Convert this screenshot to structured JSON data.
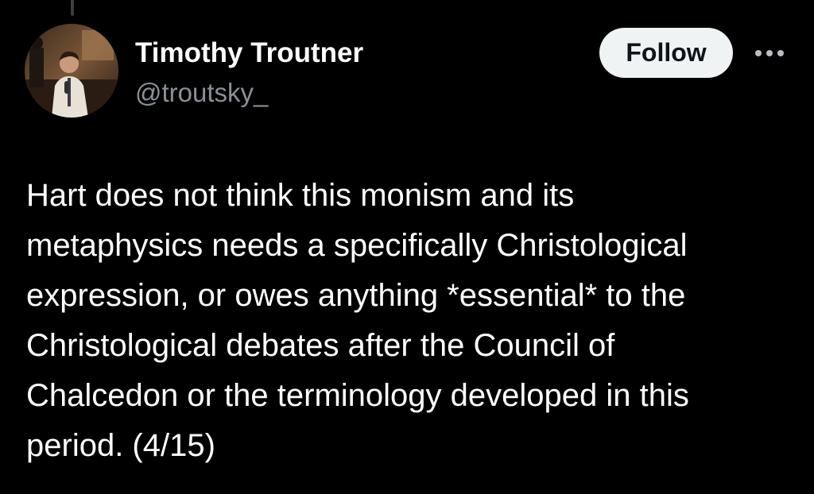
{
  "tweet": {
    "author": {
      "name": "Timothy Troutner",
      "handle": "@troutsky_"
    },
    "follow_label": "Follow",
    "more_icon": "more-horizontal-icon",
    "text": "Hart does not think this monism and its\nmetaphysics needs a specifically Christological\nexpression, or owes anything *essential* to the\nChristological debates after the Council of\nChalcedon or the terminology developed in this\nperiod. (4/15)"
  },
  "colors": {
    "background": "#000000",
    "text": "#ffffff",
    "handle": "#8b9096",
    "follow_bg": "#eff3f4",
    "follow_text": "#0f1419"
  }
}
